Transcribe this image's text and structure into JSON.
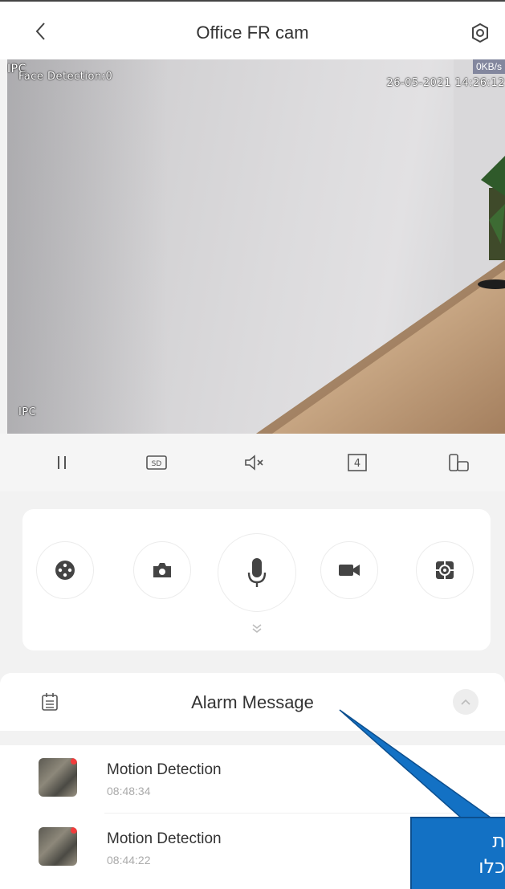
{
  "header": {
    "title": "Office FR cam",
    "back_icon": "chevron-left-icon",
    "settings_icon": "settings-icon"
  },
  "video": {
    "osd_top_left_a": "IPC",
    "osd_top_left_b": "Face Detection:0",
    "osd_timestamp": "26-05-2021 14:26:12",
    "osd_bitrate": "0KB/s",
    "osd_bottom_left": "IPC"
  },
  "toolbar": {
    "items": [
      "pause-icon",
      "sd-quality-icon",
      "mute-icon",
      "split-4-icon",
      "fullscreen-rotate-icon"
    ],
    "split_label": "4",
    "sd_label": "SD"
  },
  "controls": {
    "items": [
      "ptz-icon",
      "snapshot-camera-icon",
      "microphone-icon",
      "record-video-icon",
      "fisheye-icon"
    ],
    "expand_icon": "chevron-double-down-icon"
  },
  "alarm": {
    "title": "Alarm Message",
    "collapse_icon": "chevron-up-icon",
    "items": [
      {
        "name": "Motion Detection",
        "time": "08:48:34"
      },
      {
        "name": "Motion Detection",
        "time": "08:44:22"
      }
    ]
  },
  "callout": {
    "line1": "ת",
    "line2": "כלו"
  },
  "colors": {
    "callout_bg": "#1371c4",
    "alarm_badge": "#f23b3b"
  }
}
